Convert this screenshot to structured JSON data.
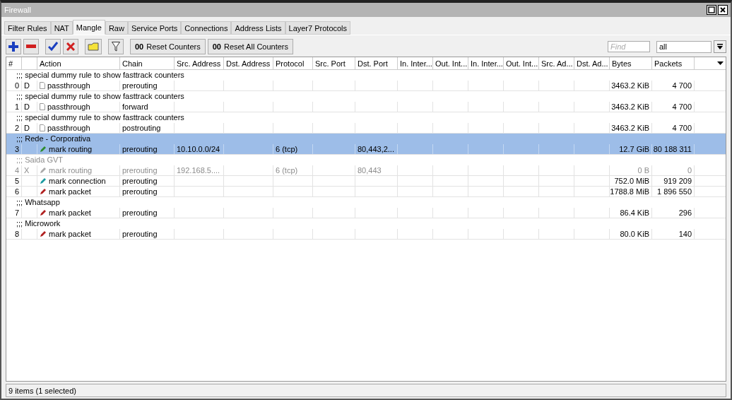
{
  "window": {
    "title": "Firewall"
  },
  "tabs": [
    {
      "label": "Filter Rules",
      "selected": false
    },
    {
      "label": "NAT",
      "selected": false
    },
    {
      "label": "Mangle",
      "selected": true
    },
    {
      "label": "Raw",
      "selected": false
    },
    {
      "label": "Service Ports",
      "selected": false
    },
    {
      "label": "Connections",
      "selected": false
    },
    {
      "label": "Address Lists",
      "selected": false
    },
    {
      "label": "Layer7 Protocols",
      "selected": false
    }
  ],
  "toolbar": {
    "reset_counters": {
      "glyph": "00",
      "label": "Reset Counters"
    },
    "reset_all_counters": {
      "glyph": "00",
      "label": "Reset All Counters"
    },
    "find_placeholder": "Find",
    "filter_value": "all"
  },
  "table": {
    "columns": [
      "#",
      "",
      "Action",
      "Chain",
      "Src. Address",
      "Dst. Address",
      "Protocol",
      "Src. Port",
      "Dst. Port",
      "In. Inter...",
      "Out. Int...",
      "In. Inter...",
      "Out. Int...",
      "Src. Ad...",
      "Dst. Ad...",
      "Bytes",
      "Packets",
      ""
    ],
    "rows": [
      {
        "comment": ";;; special dummy rule to show fasttrack counters",
        "num": "0",
        "flag": "D",
        "kind": "passthrough",
        "action": "passthrough",
        "chain": "prerouting",
        "src_address": "",
        "protocol": "",
        "dst_port": "",
        "bytes": "3463.2 KiB",
        "packets": "4 700",
        "selected": false,
        "disabled": false
      },
      {
        "comment": ";;; special dummy rule to show fasttrack counters",
        "num": "1",
        "flag": "D",
        "kind": "passthrough",
        "action": "passthrough",
        "chain": "forward",
        "src_address": "",
        "protocol": "",
        "dst_port": "",
        "bytes": "3463.2 KiB",
        "packets": "4 700",
        "selected": false,
        "disabled": false
      },
      {
        "comment": ";;; special dummy rule to show fasttrack counters",
        "num": "2",
        "flag": "D",
        "kind": "passthrough",
        "action": "passthrough",
        "chain": "postrouting",
        "src_address": "",
        "protocol": "",
        "dst_port": "",
        "bytes": "3463.2 KiB",
        "packets": "4 700",
        "selected": false,
        "disabled": false
      },
      {
        "comment": ";;; Rede - Corporativa",
        "num": "3",
        "flag": "",
        "kind": "routing",
        "action": "mark routing",
        "chain": "prerouting",
        "src_address": "10.10.0.0/24",
        "protocol": "6 (tcp)",
        "dst_port": "80,443,2...",
        "bytes": "12.7 GiB",
        "packets": "80 188 311",
        "selected": true,
        "disabled": false
      },
      {
        "comment": ";;; Saida GVT",
        "num": "4",
        "flag": "X",
        "kind": "routing",
        "action": "mark routing",
        "chain": "prerouting",
        "src_address": "192.168.5....",
        "protocol": "6 (tcp)",
        "dst_port": "80,443",
        "bytes": "0 B",
        "packets": "0",
        "selected": false,
        "disabled": true
      },
      {
        "comment": "",
        "num": "5",
        "flag": "",
        "kind": "connection",
        "action": "mark connection",
        "chain": "prerouting",
        "src_address": "",
        "protocol": "",
        "dst_port": "",
        "bytes": "752.0 MiB",
        "packets": "919 209",
        "selected": false,
        "disabled": false
      },
      {
        "comment": "",
        "num": "6",
        "flag": "",
        "kind": "packet",
        "action": "mark packet",
        "chain": "prerouting",
        "src_address": "",
        "protocol": "",
        "dst_port": "",
        "bytes": "1788.8 MiB",
        "packets": "1 896 550",
        "selected": false,
        "disabled": false
      },
      {
        "comment": ";;; Whatsapp",
        "num": "7",
        "flag": "",
        "kind": "packet",
        "action": "mark packet",
        "chain": "prerouting",
        "src_address": "",
        "protocol": "",
        "dst_port": "",
        "bytes": "86.4 KiB",
        "packets": "296",
        "selected": false,
        "disabled": false
      },
      {
        "comment": ";;; Microwork",
        "num": "8",
        "flag": "",
        "kind": "packet",
        "action": "mark packet",
        "chain": "prerouting",
        "src_address": "",
        "protocol": "",
        "dst_port": "",
        "bytes": "80.0 KiB",
        "packets": "140",
        "selected": false,
        "disabled": false
      }
    ]
  },
  "status_bar": "9 items (1 selected)"
}
